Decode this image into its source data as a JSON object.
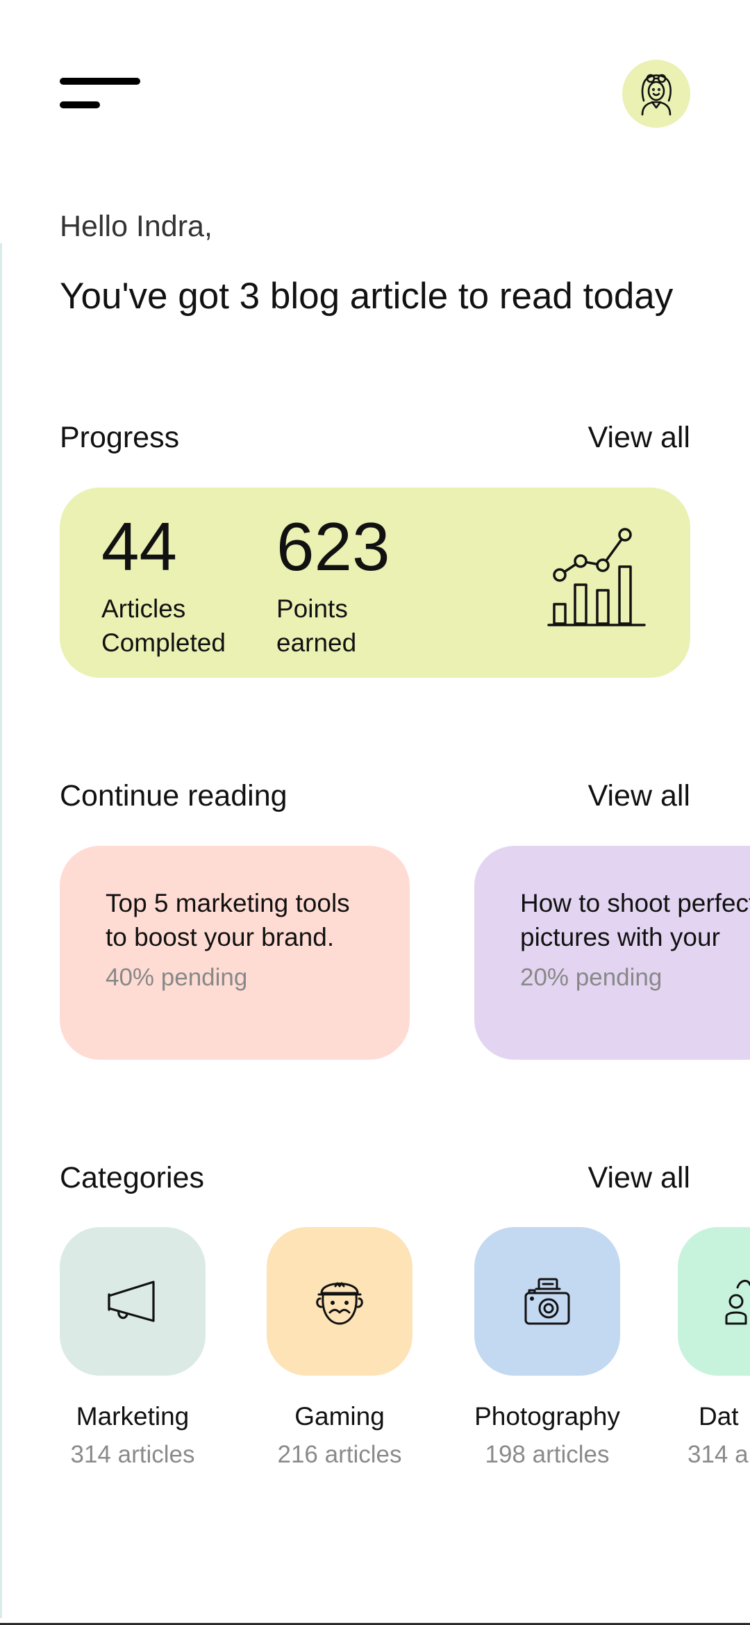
{
  "header": {
    "menu_icon": "menu-icon",
    "avatar_icon": "user-avatar-icon",
    "avatar_bg": "#eaf1b3"
  },
  "greeting": "Hello Indra,",
  "headline": "You've got 3 blog article to read today",
  "progress": {
    "title": "Progress",
    "view_all": "View all",
    "articles_value": "44",
    "articles_label": "Articles\nCompleted",
    "points_value": "623",
    "points_label": "Points\nearned",
    "chart_icon": "growth-chart-icon",
    "card_bg": "#ebf1b3"
  },
  "continue_reading": {
    "title": "Continue reading",
    "view_all": "View all",
    "items": [
      {
        "title": "Top 5 marketing tools\nto boost your brand.",
        "pending": "40% pending",
        "bg": "#fedcd4"
      },
      {
        "title": "How to shoot perfect\npictures with your",
        "pending": "20% pending",
        "bg": "#e3d5f1"
      }
    ]
  },
  "categories": {
    "title": "Categories",
    "view_all": "View all",
    "items": [
      {
        "name": "Marketing",
        "count": "314 articles",
        "icon": "megaphone-icon",
        "bg": "#dceae6"
      },
      {
        "name": "Gaming",
        "count": "216 articles",
        "icon": "game-character-icon",
        "bg": "#fde3b6"
      },
      {
        "name": "Photography",
        "count": "198 articles",
        "icon": "camera-icon",
        "bg": "#c3d8f1"
      },
      {
        "name": "Dat",
        "count": "314 a",
        "icon": "data-person-icon",
        "bg": "#c7f3dd"
      }
    ]
  }
}
